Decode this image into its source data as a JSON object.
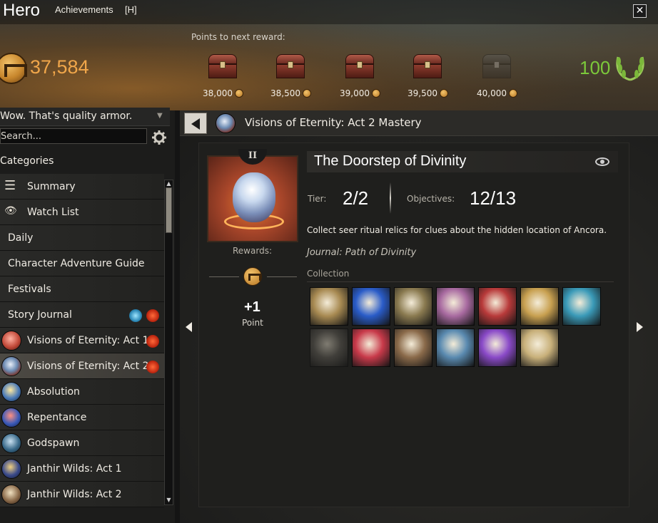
{
  "window": {
    "title": "Hero",
    "tab": "Achievements",
    "hotkey": "[H]",
    "close_label": "✕"
  },
  "header": {
    "points_label": "Points to next reward:",
    "ap_total": "37,584",
    "mastery_points": "100",
    "rewards": [
      {
        "points": "38,000",
        "state": "available"
      },
      {
        "points": "38,500",
        "state": "available"
      },
      {
        "points": "39,000",
        "state": "available"
      },
      {
        "points": "39,500",
        "state": "available"
      },
      {
        "points": "40,000",
        "state": "locked"
      }
    ]
  },
  "sidebar": {
    "selected_title": "Wow. That's quality armor.",
    "search_placeholder": "Search...",
    "categories_label": "Categories",
    "items": [
      {
        "label": "Summary",
        "icon": "menu-icon"
      },
      {
        "label": "Watch List",
        "icon": "eye-icon"
      },
      {
        "label": "Daily"
      },
      {
        "label": "Character Adventure Guide"
      },
      {
        "label": "Festivals"
      },
      {
        "label": "Story Journal",
        "flags": [
          "blue",
          "red"
        ]
      },
      {
        "label": "Visions of Eternity: Act 1",
        "icon": "voe-act1-icon",
        "flags": [
          "red"
        ]
      },
      {
        "label": "Visions of Eternity: Act 2",
        "icon": "voe-act2-icon",
        "flags": [
          "red"
        ],
        "active": true
      },
      {
        "label": "Absolution",
        "icon": "absolution-icon"
      },
      {
        "label": "Repentance",
        "icon": "repentance-icon"
      },
      {
        "label": "Godspawn",
        "icon": "godspawn-icon"
      },
      {
        "label": "Janthir Wilds: Act 1",
        "icon": "janthir-act1-icon"
      },
      {
        "label": "Janthir Wilds: Act 2",
        "icon": "janthir-act2-icon"
      }
    ]
  },
  "main": {
    "breadcrumb": "Visions of Eternity: Act 2 Mastery",
    "achievement": {
      "tier_badge": "II",
      "title": "The Doorstep of Divinity",
      "tier_label": "Tier:",
      "tier_value": "2/2",
      "objectives_label": "Objectives:",
      "objectives_value": "12/13",
      "description": "Collect seer ritual relics for clues about the hidden location of Ancora.",
      "journal": "Journal: Path of Divinity",
      "collection_label": "Collection",
      "rewards_label": "Rewards:",
      "reward_amount": "+1",
      "reward_unit": "Point"
    },
    "collection": [
      {
        "name": "scroll-map-icon",
        "done": true,
        "color": "#a88a52"
      },
      {
        "name": "blue-orb-icon",
        "done": true,
        "color": "#2a5cc8"
      },
      {
        "name": "stone-relic-icon",
        "done": true,
        "color": "#8a7a50"
      },
      {
        "name": "pink-shell-icon",
        "done": true,
        "color": "#a86aa0"
      },
      {
        "name": "red-helm-icon",
        "done": true,
        "color": "#b83a3a"
      },
      {
        "name": "golden-bowl-icon",
        "done": true,
        "color": "#c8a050"
      },
      {
        "name": "teal-book-icon",
        "done": true,
        "color": "#3a9ab8"
      },
      {
        "name": "faded-tablet-icon",
        "done": false,
        "color": "#6a665e"
      },
      {
        "name": "crimson-ring-icon",
        "done": true,
        "color": "#c83a4a"
      },
      {
        "name": "leather-pouch-icon",
        "done": true,
        "color": "#8a6a4a"
      },
      {
        "name": "rolled-scroll-icon",
        "done": true,
        "color": "#5a8ab0"
      },
      {
        "name": "potion-vial-icon",
        "done": true,
        "color": "#8a4ac8"
      },
      {
        "name": "parchment-note-icon",
        "done": true,
        "color": "#c8b07a"
      }
    ]
  }
}
